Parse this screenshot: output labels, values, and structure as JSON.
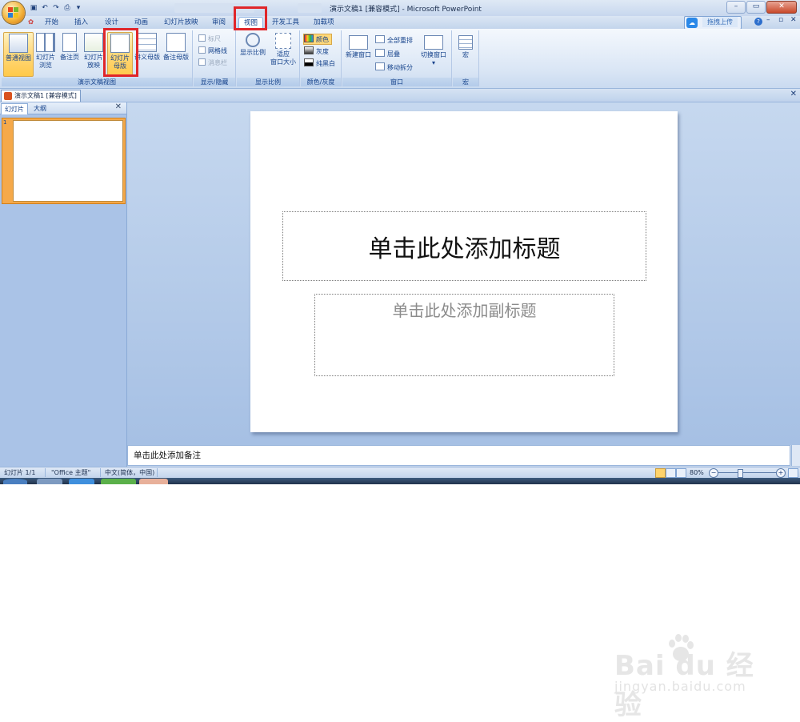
{
  "window": {
    "title": "演示文稿1 [兼容模式] - Microsoft PowerPoint",
    "controls": {
      "minimize": "–",
      "restore": "▭",
      "close": "✕"
    }
  },
  "quick_access": {
    "items": [
      "save-icon",
      "undo-icon",
      "redo-icon",
      "print-preview-icon",
      "customize-icon"
    ]
  },
  "tabs": [
    {
      "label": "开始",
      "active": false
    },
    {
      "label": "插入",
      "active": false
    },
    {
      "label": "设计",
      "active": false
    },
    {
      "label": "动画",
      "active": false
    },
    {
      "label": "幻灯片放映",
      "active": false
    },
    {
      "label": "审阅",
      "active": false
    },
    {
      "label": "视图",
      "active": true
    },
    {
      "label": "开发工具",
      "active": false
    },
    {
      "label": "加载项",
      "active": false
    }
  ],
  "cloud_upload": {
    "label": "拖拽上传"
  },
  "ribbon": {
    "groups": {
      "presentation_views": {
        "label": "演示文稿视图",
        "buttons": {
          "normal": "普通视图",
          "sorter_1": "幻灯片",
          "sorter_2": "浏览",
          "notes": "备注页",
          "show_1": "幻灯片",
          "show_2": "放映",
          "master_1": "幻灯片",
          "master_2": "母版",
          "handout": "讲义母版",
          "notes_master": "备注母版"
        }
      },
      "show_hide": {
        "label": "显示/隐藏",
        "items": [
          "标尺",
          "网格线",
          "消息栏"
        ]
      },
      "zoom": {
        "label": "显示比例",
        "zoom": "显示比例",
        "fit_1": "适应",
        "fit_2": "窗口大小"
      },
      "color": {
        "label": "颜色/灰度",
        "items": [
          "颜色",
          "灰度",
          "纯黑白"
        ]
      },
      "window": {
        "label": "窗口",
        "new_window": "新建窗口",
        "arrange_all": "全部重排",
        "cascade": "层叠",
        "move_split": "移动拆分",
        "switch": "切换窗口",
        "switch_arrow": "▾"
      },
      "macros": {
        "label": "宏",
        "button": "宏"
      }
    }
  },
  "document_tab": {
    "label": "演示文稿1 [兼容模式]",
    "close": "✕"
  },
  "left_panel": {
    "tabs": [
      "幻灯片",
      "大纲"
    ],
    "close": "✕",
    "thumb_number": "1"
  },
  "slide": {
    "title_placeholder": "单击此处添加标题",
    "subtitle_placeholder": "单击此处添加副标题"
  },
  "notes": {
    "placeholder": "单击此处添加备注"
  },
  "status": {
    "slide": "幻灯片 1/1",
    "theme": "\"Office 主题\"",
    "language": "中文(简体，中国)",
    "zoom": "80%",
    "zoom_minus": "−",
    "zoom_plus": "+"
  },
  "watermark": {
    "logo": "Bai  du 经验",
    "url": "jingyan.baidu.com"
  },
  "colors": {
    "accent_red": "#e0262a",
    "active_button": "#ffd87a",
    "ribbon_text": "#15428b"
  }
}
